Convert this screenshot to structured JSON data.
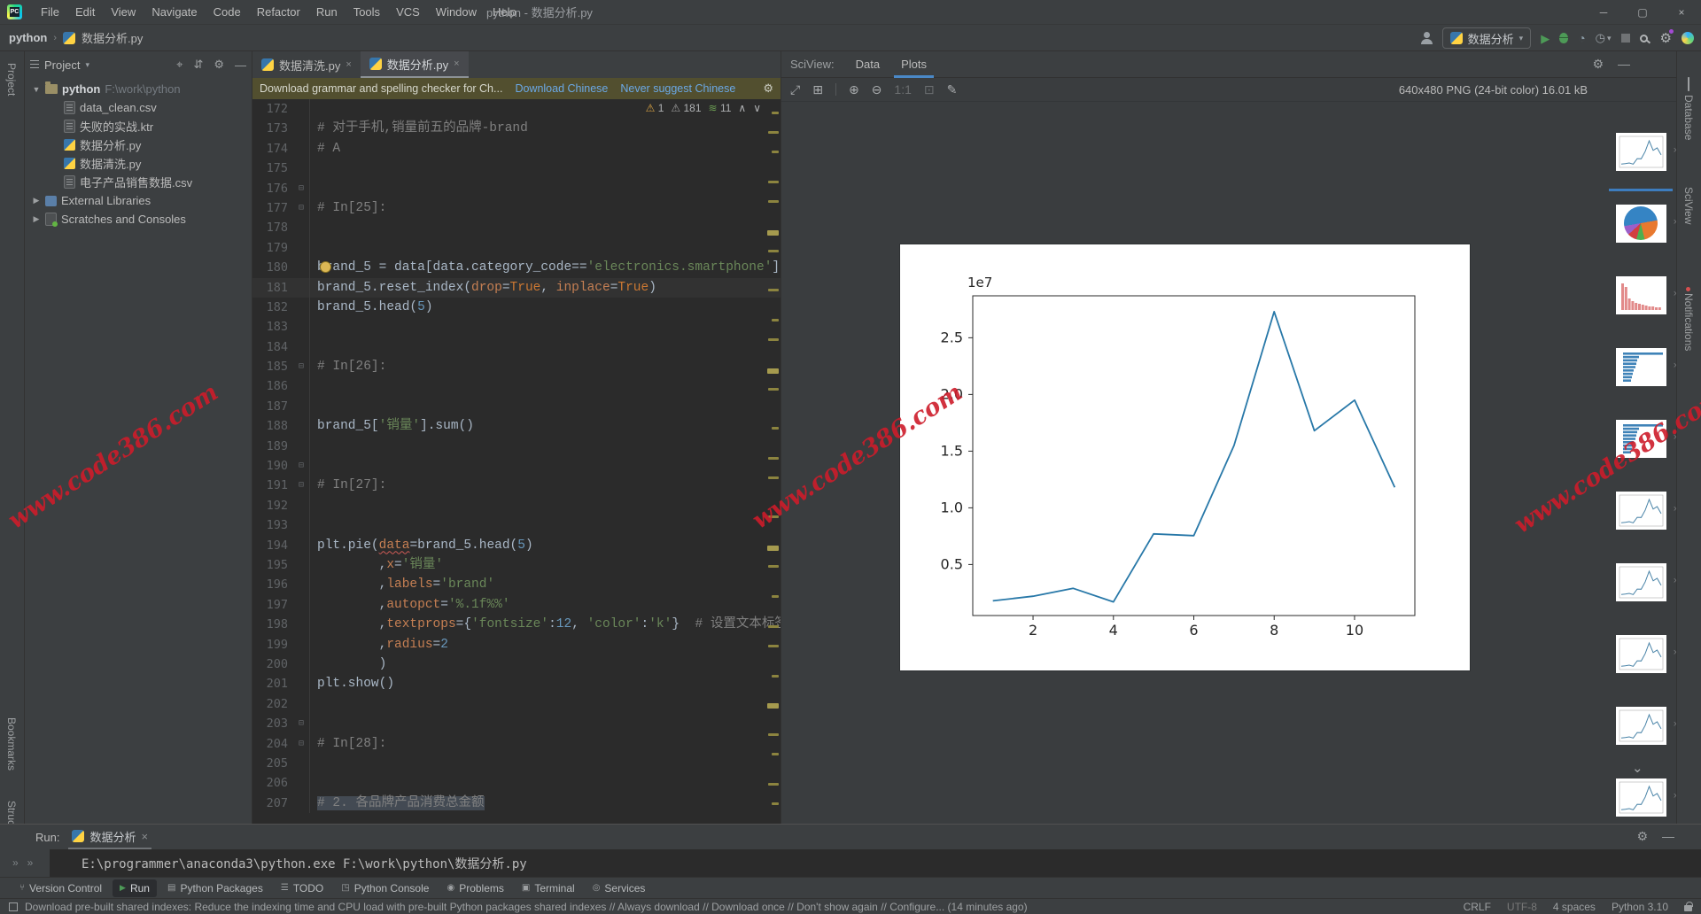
{
  "title_bar": {
    "logo": "PC",
    "menus": [
      "File",
      "Edit",
      "View",
      "Navigate",
      "Code",
      "Refactor",
      "Run",
      "Tools",
      "VCS",
      "Window",
      "Help"
    ],
    "title": "python - 数据分析.py",
    "window_controls": [
      "─",
      "▢",
      "×"
    ]
  },
  "toolbar": {
    "breadcrumb_root": "python",
    "breadcrumb_sep": "›",
    "breadcrumb_file": "数据分析.py",
    "run_config": "数据分析",
    "caret": "▾"
  },
  "left_strip": {
    "top": "Project",
    "bookmarks": "Bookmarks",
    "structure": "Structure"
  },
  "right_strip": {
    "database": "Database",
    "sciview": "SciView",
    "notifications": "Notifications"
  },
  "project": {
    "tool_label": "Project",
    "header_icons": [
      "⌖",
      "⇵",
      "⚙",
      "—"
    ],
    "root_name": "python",
    "root_path": "F:\\work\\python",
    "files": [
      {
        "name": "data_clean.csv",
        "icon": "csv"
      },
      {
        "name": "失败的实战.ktr",
        "icon": "file"
      },
      {
        "name": "数据分析.py",
        "icon": "py"
      },
      {
        "name": "数据清洗.py",
        "icon": "py"
      },
      {
        "name": "电子产品销售数据.csv",
        "icon": "csv"
      }
    ],
    "special": [
      {
        "name": "External Libraries",
        "icon": "lib"
      },
      {
        "name": "Scratches and Consoles",
        "icon": "scratch"
      }
    ]
  },
  "editor": {
    "tabs": [
      {
        "label": "数据清洗.py",
        "active": false
      },
      {
        "label": "数据分析.py",
        "active": true
      }
    ],
    "notification": {
      "text": "Download grammar and spelling checker for Ch...",
      "action1": "Download Chinese",
      "action2": "Never suggest Chinese"
    },
    "inspections": {
      "warnings": "1",
      "weak_warnings": "181",
      "typos": "11",
      "up": "∧",
      "down": "∨"
    },
    "first_line": 172,
    "lines": [
      {
        "no": 172,
        "tk": []
      },
      {
        "no": 173,
        "tk": [
          [
            "# 对于手机,销量前五的品牌-brand",
            "c"
          ]
        ]
      },
      {
        "no": 174,
        "tk": [
          [
            "# A",
            "c"
          ]
        ]
      },
      {
        "no": 175,
        "tk": []
      },
      {
        "no": 176,
        "tk": [],
        "fold": true
      },
      {
        "no": 177,
        "tk": [
          [
            "# In[25]:",
            "c"
          ]
        ],
        "fold": true
      },
      {
        "no": 178,
        "tk": []
      },
      {
        "no": 179,
        "tk": []
      },
      {
        "no": 180,
        "tk": [
          [
            "brand_5 = data[data.category_code==",
            "d"
          ],
          [
            "'electronics.smartphone'",
            "s"
          ],
          [
            "].group",
            "d"
          ]
        ],
        "bulb": true
      },
      {
        "no": 181,
        "tk": [
          [
            "brand_5.reset_index(",
            "d"
          ],
          [
            "drop",
            "a"
          ],
          [
            "=",
            "d"
          ],
          [
            "True",
            "k"
          ],
          [
            ", ",
            "d"
          ],
          [
            "inplace",
            "a"
          ],
          [
            "=",
            "d"
          ],
          [
            "True",
            "k"
          ],
          [
            ")",
            "d"
          ]
        ],
        "cur": true
      },
      {
        "no": 182,
        "tk": [
          [
            "brand_5.head(",
            "d"
          ],
          [
            "5",
            "n"
          ],
          [
            ")",
            "d"
          ]
        ]
      },
      {
        "no": 183,
        "tk": []
      },
      {
        "no": 184,
        "tk": []
      },
      {
        "no": 185,
        "tk": [
          [
            "# In[26]:",
            "c"
          ]
        ],
        "fold": true
      },
      {
        "no": 186,
        "tk": []
      },
      {
        "no": 187,
        "tk": []
      },
      {
        "no": 188,
        "tk": [
          [
            "brand_5[",
            "d"
          ],
          [
            "'销量'",
            "s"
          ],
          [
            "].sum()",
            "d"
          ]
        ]
      },
      {
        "no": 189,
        "tk": []
      },
      {
        "no": 190,
        "tk": [],
        "fold": true
      },
      {
        "no": 191,
        "tk": [
          [
            "# In[27]:",
            "c"
          ]
        ],
        "fold": true
      },
      {
        "no": 192,
        "tk": []
      },
      {
        "no": 193,
        "tk": []
      },
      {
        "no": 194,
        "tk": [
          [
            "plt.pie(",
            "d"
          ],
          [
            "data",
            "e"
          ],
          [
            "=brand_5.head(",
            "d"
          ],
          [
            "5",
            "n"
          ],
          [
            ")",
            "d"
          ]
        ]
      },
      {
        "no": 195,
        "tk": [
          [
            "        ,",
            "d"
          ],
          [
            "x",
            "a"
          ],
          [
            "=",
            "d"
          ],
          [
            "'销量'",
            "s"
          ]
        ]
      },
      {
        "no": 196,
        "tk": [
          [
            "        ,",
            "d"
          ],
          [
            "labels",
            "a"
          ],
          [
            "=",
            "d"
          ],
          [
            "'brand'",
            "s"
          ]
        ]
      },
      {
        "no": 197,
        "tk": [
          [
            "        ,",
            "d"
          ],
          [
            "autopct",
            "a"
          ],
          [
            "=",
            "d"
          ],
          [
            "'%.1f%%'",
            "s"
          ]
        ]
      },
      {
        "no": 198,
        "tk": [
          [
            "        ,",
            "d"
          ],
          [
            "textprops",
            "a"
          ],
          [
            "={",
            "d"
          ],
          [
            "'fontsize'",
            "s"
          ],
          [
            ":",
            "d"
          ],
          [
            "12",
            "n"
          ],
          [
            ", ",
            "d"
          ],
          [
            "'color'",
            "s"
          ],
          [
            ":",
            "d"
          ],
          [
            "'k'",
            "s"
          ],
          [
            "}  ",
            "d"
          ],
          [
            "# 设置文本标签的属性值",
            "c"
          ]
        ]
      },
      {
        "no": 199,
        "tk": [
          [
            "        ,",
            "d"
          ],
          [
            "radius",
            "a"
          ],
          [
            "=",
            "d"
          ],
          [
            "2",
            "n"
          ]
        ]
      },
      {
        "no": 200,
        "tk": [
          [
            "        )",
            "d"
          ]
        ]
      },
      {
        "no": 201,
        "tk": [
          [
            "plt.show()",
            "d"
          ]
        ]
      },
      {
        "no": 202,
        "tk": []
      },
      {
        "no": 203,
        "tk": [],
        "fold": true
      },
      {
        "no": 204,
        "tk": [
          [
            "# In[28]:",
            "c"
          ]
        ],
        "fold": true
      },
      {
        "no": 205,
        "tk": []
      },
      {
        "no": 206,
        "tk": []
      },
      {
        "no": 207,
        "tk": [
          [
            "# 2. 各品牌产品消费总金额",
            "c"
          ]
        ],
        "sel": true
      }
    ],
    "scroll_marks": [
      [
        14,
        1
      ],
      [
        36,
        2
      ],
      [
        58,
        1
      ],
      [
        92,
        2
      ],
      [
        114,
        2
      ],
      [
        148,
        3
      ],
      [
        170,
        2
      ],
      [
        214,
        2
      ],
      [
        248,
        1
      ],
      [
        270,
        2
      ],
      [
        304,
        3
      ],
      [
        326,
        2
      ],
      [
        370,
        1
      ],
      [
        404,
        2
      ],
      [
        426,
        2
      ],
      [
        470,
        2
      ],
      [
        504,
        3
      ],
      [
        526,
        2
      ],
      [
        560,
        1
      ],
      [
        594,
        2
      ],
      [
        616,
        2
      ],
      [
        650,
        1
      ],
      [
        682,
        3
      ],
      [
        716,
        2
      ],
      [
        738,
        1
      ],
      [
        772,
        2
      ],
      [
        794,
        1
      ]
    ]
  },
  "sciview": {
    "label": "SciView:",
    "tabs": [
      {
        "label": "Data",
        "active": false
      },
      {
        "label": "Plots",
        "active": true
      }
    ],
    "toolbar_icons": [
      "⤢",
      "⊞",
      "⊕",
      "⊖",
      "1:1",
      "⊡",
      "✎"
    ],
    "image_info": "640x480 PNG (24-bit color) 16.01 kB",
    "thumbs": [
      "line",
      "pie",
      "bar",
      "hbar",
      "hbar",
      "line",
      "line",
      "line",
      "line",
      "line"
    ],
    "more_chevron": "⌄"
  },
  "chart_data": {
    "type": "line",
    "x": [
      1,
      2,
      3,
      4,
      5,
      6,
      7,
      8,
      9,
      10,
      11
    ],
    "y": [
      1800000,
      2200000,
      2900000,
      1700000,
      7700000,
      7550000,
      15500000,
      27300000,
      16800000,
      19500000,
      11800000
    ],
    "title": "",
    "xlabel": "",
    "ylabel": "",
    "offset_label": "1e7",
    "xticks": [
      2,
      4,
      6,
      8,
      10
    ],
    "yticks": [
      5000000,
      10000000,
      15000000,
      20000000,
      25000000
    ],
    "ytick_labels": [
      "0.5",
      "1.0",
      "1.5",
      "2.0",
      "2.5"
    ],
    "xlim": [
      0.5,
      11.5
    ],
    "ylim": [
      500000,
      28700000
    ],
    "line_color": "#2878a8",
    "grid": false,
    "legend": null
  },
  "run_panel": {
    "label": "Run:",
    "tab": "数据分析",
    "close": "×",
    "gutter_chevrons": "»»",
    "console_line": "E:\\programmer\\anaconda3\\python.exe F:\\work\\python\\数据分析.py"
  },
  "bottom_bar": {
    "items": [
      {
        "label": "Version Control",
        "icon": "branch",
        "active": false
      },
      {
        "label": "Run",
        "icon": "play",
        "active": true
      },
      {
        "label": "Python Packages",
        "icon": "packages",
        "active": false
      },
      {
        "label": "TODO",
        "icon": "todo",
        "active": false
      },
      {
        "label": "Python Console",
        "icon": "python",
        "active": false
      },
      {
        "label": "Problems",
        "icon": "problems",
        "active": false
      },
      {
        "label": "Terminal",
        "icon": "terminal",
        "active": false
      },
      {
        "label": "Services",
        "icon": "services",
        "active": false
      }
    ]
  },
  "status_bar": {
    "message": "Download pre-built shared indexes: Reduce the indexing time and CPU load with pre-built Python packages shared indexes // Always download // Download once // Don't show again // Configure... (14 minutes ago)",
    "line_ending": "CRLF",
    "encoding": "UTF-8",
    "indent": "4 spaces",
    "interpreter": "Python 3.10"
  },
  "watermark": {
    "text": "www.code386.com"
  }
}
